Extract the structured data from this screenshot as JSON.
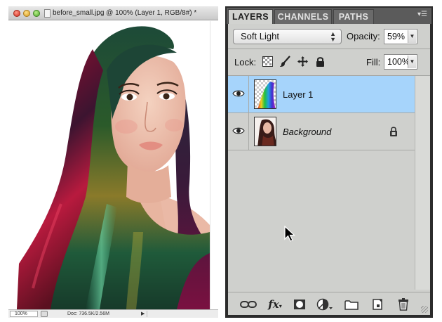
{
  "document": {
    "title": "before_small.jpg @ 100% (Layer 1, RGB/8#) *",
    "zoom": "100%",
    "doc_size": "Doc: 736.5K/2.56M"
  },
  "panel": {
    "tabs": [
      {
        "label": "LAYERS",
        "active": true
      },
      {
        "label": "CHANNELS",
        "active": false
      },
      {
        "label": "PATHS",
        "active": false
      }
    ],
    "blend_mode": "Soft Light",
    "opacity_label": "Opacity:",
    "opacity_value": "59%",
    "lock_label": "Lock:",
    "fill_label": "Fill:",
    "fill_value": "100%",
    "layers": [
      {
        "name": "Layer 1",
        "selected": true,
        "visible": true,
        "locked": false
      },
      {
        "name": "Background",
        "selected": false,
        "visible": true,
        "locked": true
      }
    ],
    "footer_buttons": [
      "link-icon",
      "fx-icon",
      "mask-icon",
      "adjustment-icon",
      "folder-icon",
      "new-layer-icon",
      "trash-icon"
    ]
  },
  "colors": {
    "selection": "#a6d4fb",
    "panel_bg": "#cfd0cd",
    "panel_frame": "#2b2b2b"
  }
}
